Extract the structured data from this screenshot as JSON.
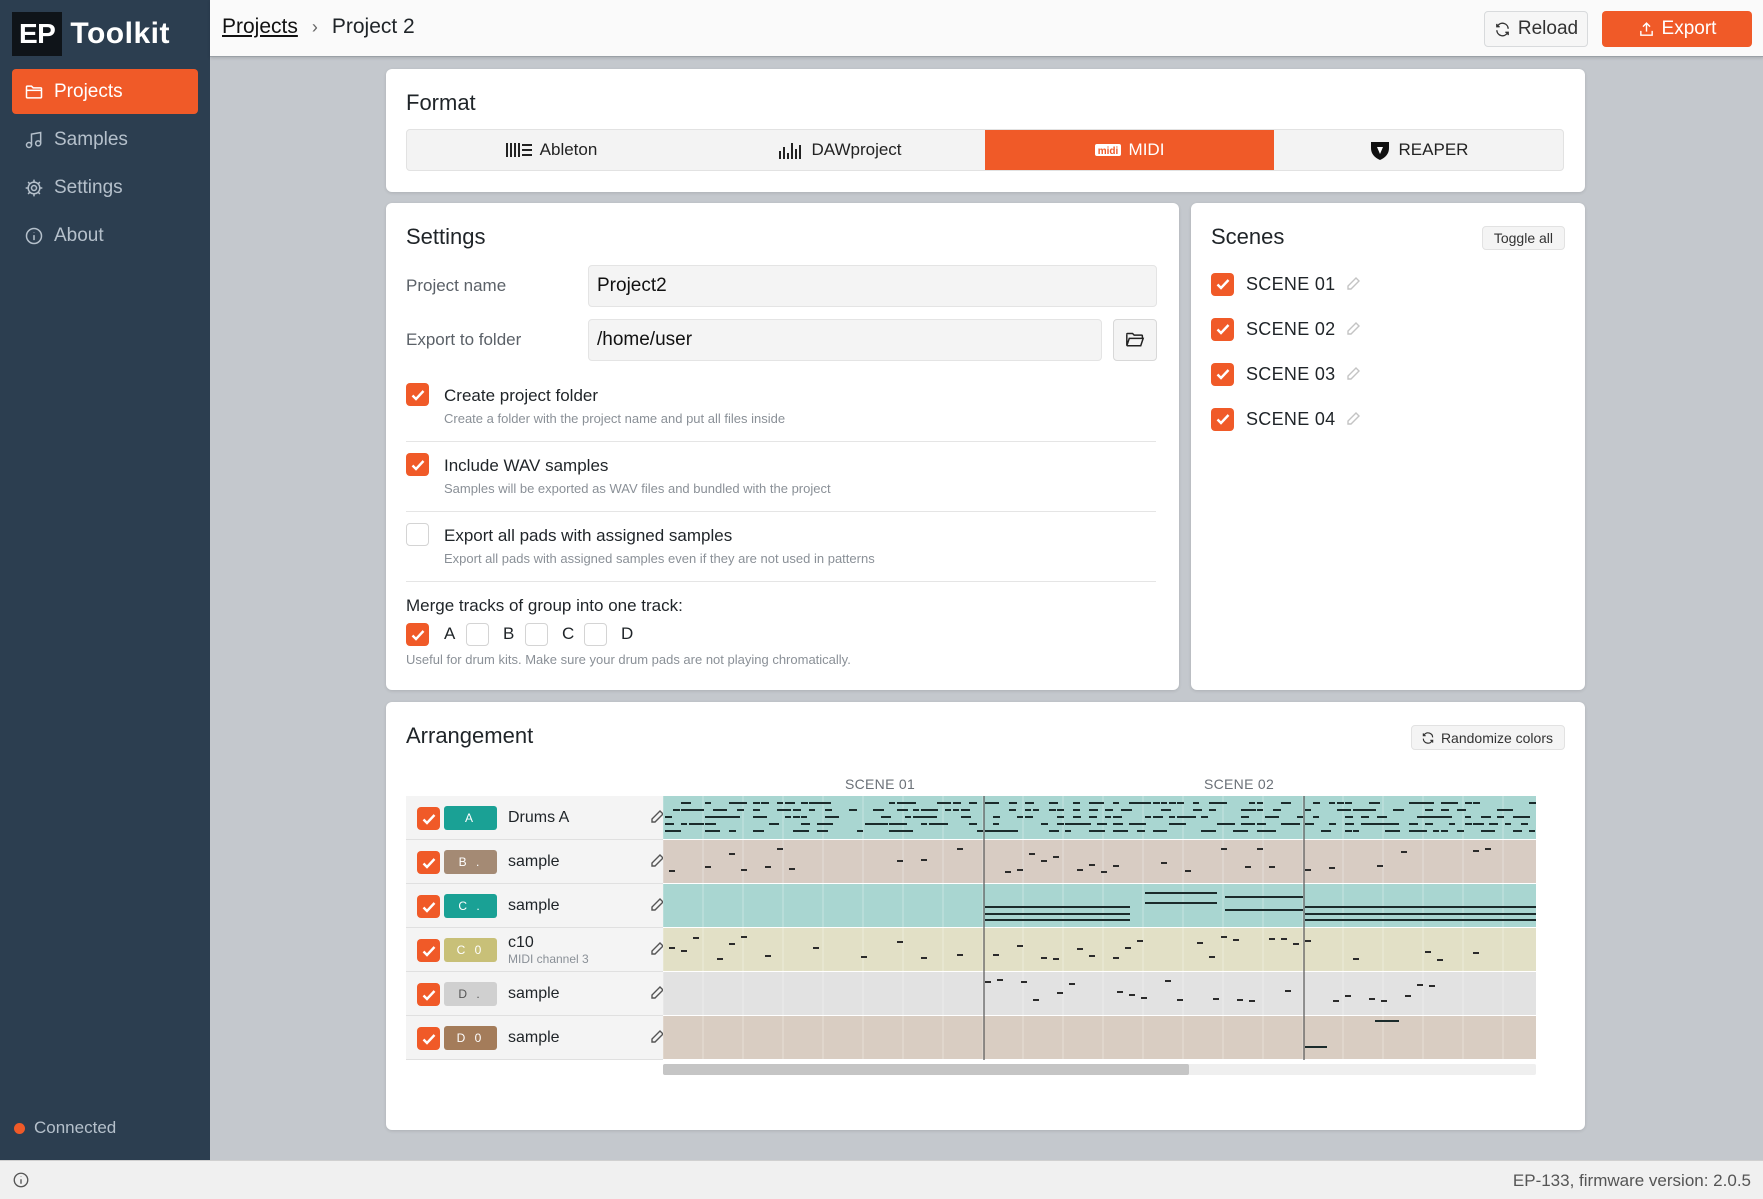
{
  "app": {
    "logo_ep": "EP",
    "logo_name": "Toolkit"
  },
  "sidebar": {
    "items": [
      {
        "label": "Projects",
        "icon": "folder-icon",
        "active": true
      },
      {
        "label": "Samples",
        "icon": "music-note-icon",
        "active": false
      },
      {
        "label": "Settings",
        "icon": "gear-icon",
        "active": false
      },
      {
        "label": "About",
        "icon": "info-icon",
        "active": false
      }
    ],
    "status": "Connected",
    "status_color": "#f05a28"
  },
  "header": {
    "breadcrumb_root": "Projects",
    "breadcrumb_sep": "›",
    "breadcrumb_current": "Project 2",
    "reload_label": "Reload",
    "export_label": "Export"
  },
  "format": {
    "title": "Format",
    "options": [
      {
        "label": "Ableton",
        "icon": "ableton-icon",
        "selected": false
      },
      {
        "label": "DAWproject",
        "icon": "dawproject-icon",
        "selected": false
      },
      {
        "label": "MIDI",
        "icon": "midi-icon",
        "selected": true
      },
      {
        "label": "REAPER",
        "icon": "reaper-icon",
        "selected": false
      }
    ]
  },
  "settings": {
    "title": "Settings",
    "project_name_label": "Project name",
    "project_name_value": "Project2",
    "export_folder_label": "Export to folder",
    "export_folder_value": "/home/user",
    "options": [
      {
        "title": "Create project folder",
        "desc": "Create a folder with the project name and put all files inside",
        "checked": true
      },
      {
        "title": "Include WAV samples",
        "desc": "Samples will be exported as WAV files and bundled with the project",
        "checked": true
      },
      {
        "title": "Export all pads with assigned samples",
        "desc": "Export all pads with assigned samples even if they are not used in patterns",
        "checked": false
      }
    ],
    "merge_title": "Merge tracks of group into one track:",
    "merge_groups": [
      {
        "label": "A",
        "checked": true
      },
      {
        "label": "B",
        "checked": false
      },
      {
        "label": "C",
        "checked": false
      },
      {
        "label": "D",
        "checked": false
      }
    ],
    "merge_hint": "Useful for drum kits. Make sure your drum pads are not playing chromatically."
  },
  "scenes": {
    "title": "Scenes",
    "toggle_label": "Toggle all",
    "items": [
      {
        "label": "SCENE 01",
        "checked": true
      },
      {
        "label": "SCENE 02",
        "checked": true
      },
      {
        "label": "SCENE 03",
        "checked": true
      },
      {
        "label": "SCENE 04",
        "checked": true
      }
    ]
  },
  "arrangement": {
    "title": "Arrangement",
    "randomize_label": "Randomize colors",
    "scene_headers": [
      "SCENE 01",
      "SCENE 02"
    ],
    "tracks": [
      {
        "badge": "A",
        "badge_color": "#1aa195",
        "lane_color": "#a9d6d1",
        "name": "Drums A",
        "sub": ""
      },
      {
        "badge": "B .",
        "badge_color": "#a48a74",
        "lane_color": "#d8ccc3",
        "name": "sample",
        "sub": ""
      },
      {
        "badge": "C .",
        "badge_color": "#1aa195",
        "lane_color": "#a9d6d1",
        "name": "sample",
        "sub": ""
      },
      {
        "badge": "C 0",
        "badge_color": "#c8c078",
        "lane_color": "#e2e0c6",
        "name": "c10",
        "sub": "MIDI channel 3"
      },
      {
        "badge": "D .",
        "badge_color": "#d0d0d0",
        "lane_color": "#e2e2e2",
        "name": "sample",
        "sub": ""
      },
      {
        "badge": "D 0",
        "badge_color": "#a47c5a",
        "lane_color": "#d9cdc2",
        "name": "sample",
        "sub": ""
      }
    ]
  },
  "footer": {
    "firmware": "EP-133, firmware version: 2.0.5"
  },
  "colors": {
    "accent": "#f05a28",
    "sidebar_bg": "#2c3e50"
  }
}
